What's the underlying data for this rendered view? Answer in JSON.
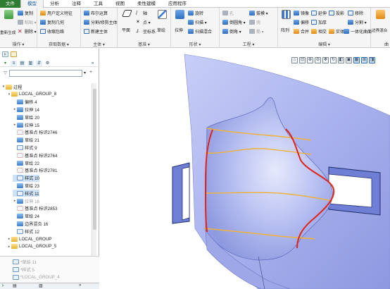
{
  "tabs": [
    {
      "label": "文件",
      "active": false,
      "file": true
    },
    {
      "label": "模型",
      "active": true,
      "file": false
    },
    {
      "label": "分析",
      "active": false,
      "file": false
    },
    {
      "label": "注释",
      "active": false,
      "file": false
    },
    {
      "label": "工具",
      "active": false,
      "file": false
    },
    {
      "label": "视图",
      "active": false,
      "file": false
    },
    {
      "label": "柔性建模",
      "active": false,
      "file": false
    },
    {
      "label": "应用程序",
      "active": false,
      "file": false
    }
  ],
  "ribbon": {
    "operations": {
      "label": "操作 ▾",
      "regenerate": "重新生成",
      "copy": "复制",
      "paste": "粘贴 ▾",
      "delete": "删除 ▾"
    },
    "get_data": {
      "label": "获取数据 ▾",
      "udf": "用户定义特征",
      "copy_geom": "复制几何",
      "shrinkwrap": "收缩包络"
    },
    "body": {
      "label": "主体 ▾",
      "boolean": "布尔运算",
      "split": "分割/修剪主体",
      "new_body": "新建主体"
    },
    "datum": {
      "label": "基准 ▾",
      "plane": "平面",
      "axis": "轴",
      "point": "点 ▾",
      "csys": "坐标系",
      "sketch": "草绘"
    },
    "shapes": {
      "label": "形状 ▾",
      "extrude": "拉伸",
      "revolve": "旋转",
      "sweep": "扫描 ▾",
      "swept_blend": "扫描混合"
    },
    "engineering": {
      "label": "工程 ▾",
      "hole": "孔",
      "round": "倒圆角 ▾",
      "chamfer": "倒角 ▾",
      "draft": "拔模 ▾",
      "shell": "壳",
      "rib": "筋 ▾",
      "pattern": "阵列"
    },
    "editing": {
      "label": "编辑 ▾",
      "mirror": "镜像",
      "extend": "延伸",
      "project": "投影",
      "trim": "修剪",
      "offset": "偏移",
      "thicken": "加厚",
      "merge": "合并",
      "intersect": "相交",
      "solidify": "实体化",
      "remove": "移除",
      "split": "分割 ▾",
      "unify": "一体化曲面"
    },
    "surfaces": {
      "label": "曲",
      "boundary_blend": "边界混合"
    }
  },
  "left_pane": {
    "search_placeholder": "",
    "tree": [
      {
        "label": "过程",
        "indent": 0,
        "arrow": "▾",
        "icon": "folder-icon",
        "state": "normal"
      },
      {
        "label": "LOCAL_GROUP_8",
        "indent": 1,
        "arrow": "▾",
        "icon": "group-icon",
        "state": "normal"
      },
      {
        "label": "偏移 4",
        "indent": 2,
        "arrow": "",
        "icon": "offset-icon",
        "state": "normal"
      },
      {
        "label": "拉伸 14",
        "indent": 2,
        "arrow": "▸",
        "icon": "extrude-icon",
        "state": "normal"
      },
      {
        "label": "草绘 20",
        "indent": 2,
        "arrow": "",
        "icon": "sketch-icon",
        "state": "normal"
      },
      {
        "label": "拉伸 15",
        "indent": 2,
        "arrow": "▸",
        "icon": "extrude-icon",
        "state": "normal"
      },
      {
        "label": "基准点 标识2746",
        "indent": 2,
        "arrow": "",
        "icon": "datum-point-icon",
        "state": "normal"
      },
      {
        "label": "草绘 21",
        "indent": 2,
        "arrow": "",
        "icon": "sketch-icon",
        "state": "normal"
      },
      {
        "label": "样式 9",
        "indent": 2,
        "arrow": "",
        "icon": "style-icon",
        "state": "normal"
      },
      {
        "label": "基准点 标识2764",
        "indent": 2,
        "arrow": "",
        "icon": "datum-point-icon",
        "state": "normal"
      },
      {
        "label": "草绘 22",
        "indent": 2,
        "arrow": "",
        "icon": "sketch-icon",
        "state": "normal"
      },
      {
        "label": "基准点 标识2781",
        "indent": 2,
        "arrow": "",
        "icon": "datum-point-icon",
        "state": "normal"
      },
      {
        "label": "样式 10",
        "indent": 2,
        "arrow": "",
        "icon": "style-icon",
        "state": "selected"
      },
      {
        "label": "草绘 23",
        "indent": 2,
        "arrow": "",
        "icon": "sketch-icon",
        "state": "normal"
      },
      {
        "label": "样式 11",
        "indent": 2,
        "arrow": "",
        "icon": "style-icon",
        "state": "selected"
      },
      {
        "label": "拉伸 16",
        "indent": 2,
        "arrow": "▸",
        "icon": "extrude-icon",
        "state": "dim"
      },
      {
        "label": "基准点 标识2853",
        "indent": 2,
        "arrow": "",
        "icon": "datum-point-icon",
        "state": "normal"
      },
      {
        "label": "草绘 24",
        "indent": 2,
        "arrow": "",
        "icon": "sketch-icon",
        "state": "normal"
      },
      {
        "label": "边界混合 16",
        "indent": 2,
        "arrow": "",
        "icon": "boundary-blend-icon",
        "state": "normal"
      },
      {
        "label": "样式 12",
        "indent": 2,
        "arrow": "",
        "icon": "style-icon",
        "state": "normal"
      },
      {
        "label": "LOCAL_GROUP",
        "indent": 1,
        "arrow": "▸",
        "icon": "group-icon",
        "state": "normal"
      },
      {
        "label": "LOCAL_GROUP_5",
        "indent": 1,
        "arrow": "▸",
        "icon": "group-icon",
        "state": "normal"
      }
    ],
    "bottom_items": [
      {
        "label": "*草绘 11",
        "state": "dim"
      },
      {
        "label": "*样式 5",
        "state": "dim"
      },
      {
        "label": "*LOCAL_GROUP_4",
        "state": "dim"
      }
    ]
  },
  "viewport": {
    "tools": [
      "refit-icon",
      "zoom-window-icon",
      "zoom-in-icon",
      "zoom-out-icon",
      "pan-icon",
      "repaint-icon",
      "display-style-icon",
      "saved-views-icon",
      "view-manager-icon",
      "datum-display-icon",
      "annotation-display-icon"
    ],
    "colors": {
      "surface": "#a9b4ef",
      "curve_red": "#e0231b",
      "curve_orange": "#f0b23a",
      "edge": "#2b3a7a"
    }
  }
}
